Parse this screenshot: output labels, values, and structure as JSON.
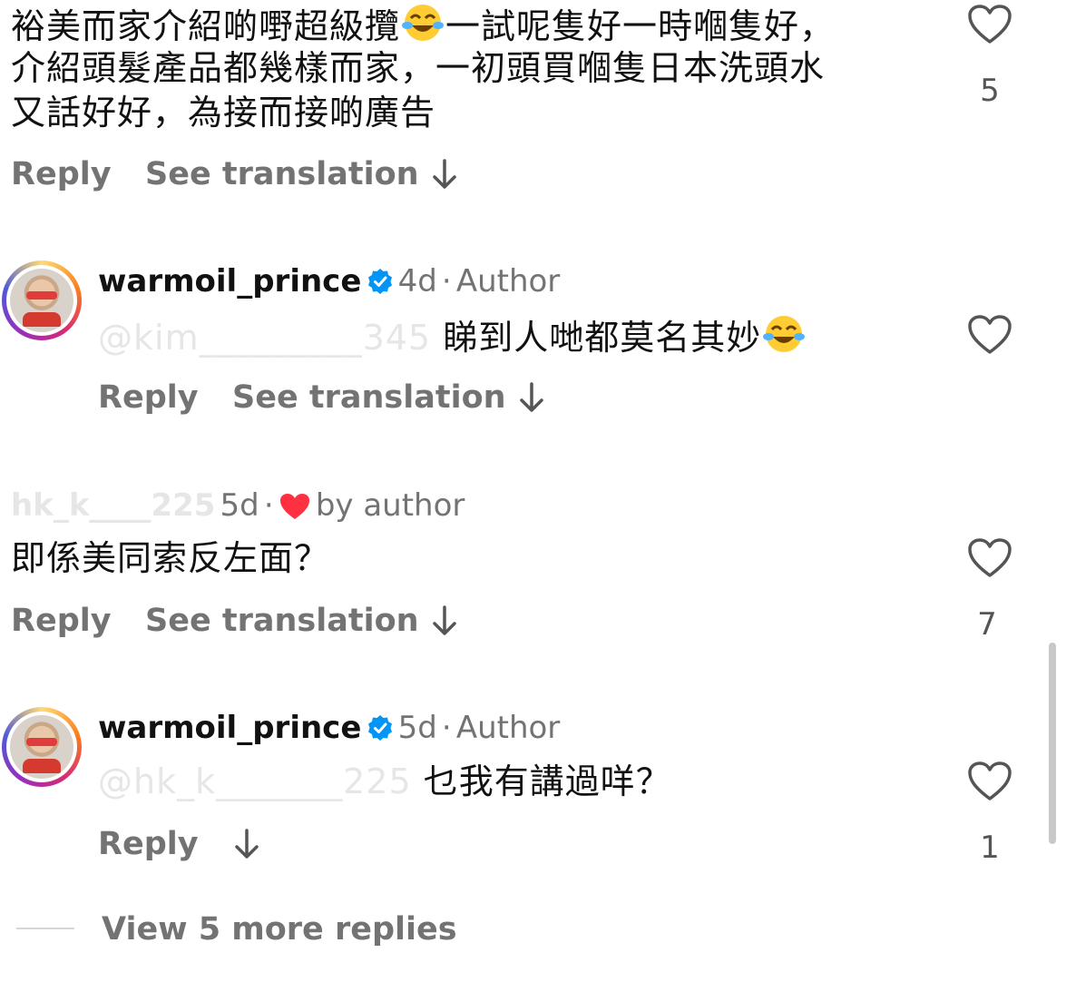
{
  "comments": [
    {
      "text_lines": [
        "裕美而家介紹啲嘢超級攬",
        "一試呢隻好一時嗰隻好，",
        "介紹頭髮產品都幾樣而家，一初頭買嗰隻日本洗頭水",
        "又話好好，為接而接啲廣告"
      ],
      "reply_label": "Reply",
      "translate_label": "See translation",
      "like_count": "5"
    },
    {
      "username": "warmoil_prince",
      "time": "4d",
      "separator": "·",
      "badge": "Author",
      "mention_faded": "@kim_________345",
      "text": "睇到人哋都莫名其妙",
      "reply_label": "Reply",
      "translate_label": "See translation"
    },
    {
      "username_faded": "hk_k____225",
      "time": "5d",
      "separator": "·",
      "liked_by": "by author",
      "text": "即係美同索反左面？",
      "reply_label": "Reply",
      "translate_label": "See translation",
      "like_count": "7"
    },
    {
      "username": "warmoil_prince",
      "time": "5d",
      "separator": "·",
      "badge": "Author",
      "mention_faded": "@hk_k_______225",
      "text": "乜我有講過咩？",
      "reply_label": "Reply",
      "like_count": "1"
    }
  ],
  "view_more": "View 5 more replies",
  "icons": {
    "heart": "heart-outline-icon",
    "translate": "arrow-down-icon",
    "verified": "verified-badge-icon",
    "emoji": "face-with-tears-of-joy-icon",
    "liked": "red-heart-icon"
  },
  "colors": {
    "verified_blue": "#0095f6",
    "liked_red": "#ff3040",
    "muted_text": "#737373"
  }
}
